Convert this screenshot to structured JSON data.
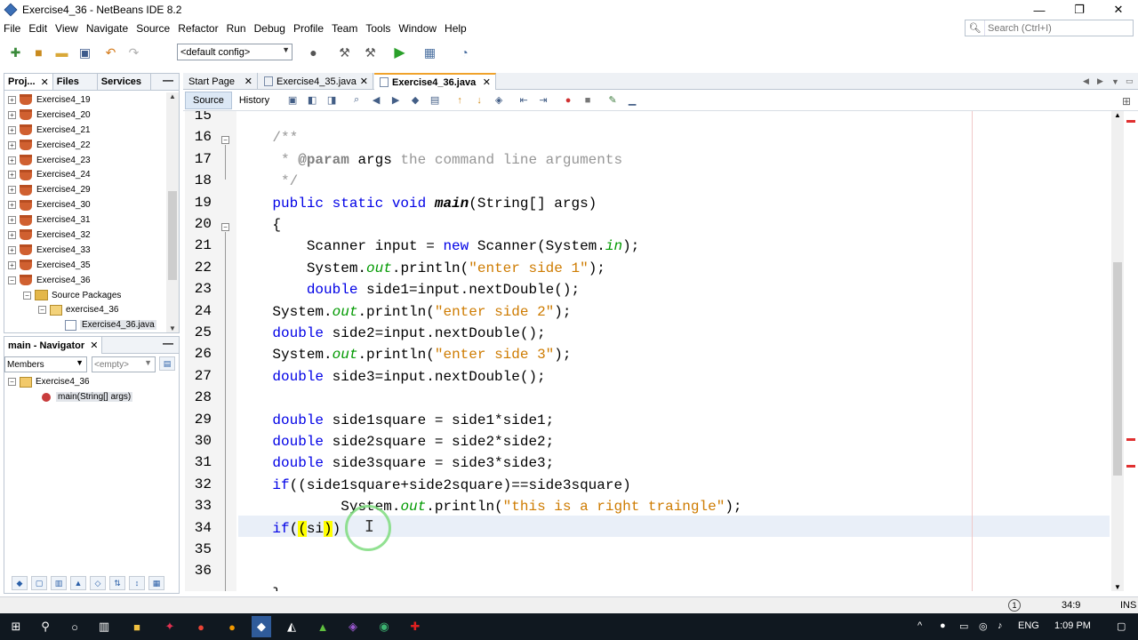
{
  "window": {
    "title": "Exercise4_36 - NetBeans IDE 8.2",
    "min": "—",
    "max": "❐",
    "close": "✕"
  },
  "menu": [
    "File",
    "Edit",
    "View",
    "Navigate",
    "Source",
    "Refactor",
    "Run",
    "Debug",
    "Profile",
    "Team",
    "Tools",
    "Window",
    "Help"
  ],
  "search": {
    "placeholder": "Search (Ctrl+I)"
  },
  "toolbar": {
    "config": "<default config>"
  },
  "projects_panel": {
    "tabs": [
      "Proj...",
      "Files",
      "Services"
    ],
    "close": "✕",
    "minimize": "—",
    "items": [
      {
        "label": "Exercise4_19",
        "indent": 0,
        "type": "project",
        "exp": "+"
      },
      {
        "label": "Exercise4_20",
        "indent": 0,
        "type": "project",
        "exp": "+"
      },
      {
        "label": "Exercise4_21",
        "indent": 0,
        "type": "project",
        "exp": "+"
      },
      {
        "label": "Exercise4_22",
        "indent": 0,
        "type": "project",
        "exp": "+"
      },
      {
        "label": "Exercise4_23",
        "indent": 0,
        "type": "project",
        "exp": "+"
      },
      {
        "label": "Exercise4_24",
        "indent": 0,
        "type": "project",
        "exp": "+"
      },
      {
        "label": "Exercise4_29",
        "indent": 0,
        "type": "project",
        "exp": "+"
      },
      {
        "label": "Exercise4_30",
        "indent": 0,
        "type": "project",
        "exp": "+"
      },
      {
        "label": "Exercise4_31",
        "indent": 0,
        "type": "project",
        "exp": "+"
      },
      {
        "label": "Exercise4_32",
        "indent": 0,
        "type": "project",
        "exp": "+"
      },
      {
        "label": "Exercise4_33",
        "indent": 0,
        "type": "project",
        "exp": "+"
      },
      {
        "label": "Exercise4_35",
        "indent": 0,
        "type": "project",
        "exp": "+"
      },
      {
        "label": "Exercise4_36",
        "indent": 0,
        "type": "project",
        "exp": "−"
      },
      {
        "label": "Source Packages",
        "indent": 1,
        "type": "folder",
        "exp": "−"
      },
      {
        "label": "exercise4_36",
        "indent": 2,
        "type": "package",
        "exp": "−"
      },
      {
        "label": "Exercise4_36.java",
        "indent": 3,
        "type": "file",
        "exp": ""
      }
    ]
  },
  "navigator": {
    "title": "main - Navigator",
    "close": "✕",
    "minimize": "—",
    "members_label": "Members",
    "filter_label": "<empty>",
    "items": [
      {
        "label": "Exercise4_36",
        "type": "class"
      },
      {
        "label": "main(String[] args)",
        "type": "method"
      }
    ]
  },
  "editor_tabs": [
    {
      "label": "Start Page",
      "active": false
    },
    {
      "label": "Exercise4_35.java",
      "active": false
    },
    {
      "label": "Exercise4_36.java",
      "active": true
    }
  ],
  "editor_toolbar": {
    "source": "Source",
    "history": "History"
  },
  "code_lines": [
    {
      "n": "15",
      "html": ""
    },
    {
      "n": "16",
      "html": "<span class=\"cm\">    /**</span>"
    },
    {
      "n": "17",
      "html": "<span class=\"cm\">     * </span><span class=\"cmtag\">@param</span><span class=\"cm\"> </span>args<span class=\"cm\"> the command line arguments</span>"
    },
    {
      "n": "18",
      "html": "<span class=\"cm\">     */</span>"
    },
    {
      "n": "19",
      "html": "    <span class=\"kw\">public static void</span> <span class=\"mth\">main</span>(String[] args)"
    },
    {
      "n": "20",
      "html": "    {"
    },
    {
      "n": "21",
      "html": "        Scanner input = <span class=\"kw\">new</span> Scanner(System.<span class=\"fld\">in</span>);"
    },
    {
      "n": "22",
      "html": "        System.<span class=\"fld\">out</span>.println(<span class=\"str\">\"enter side 1\"</span>);"
    },
    {
      "n": "23",
      "html": "        <span class=\"kw\">double</span> side1=input.nextDouble();"
    },
    {
      "n": "24",
      "html": "    System.<span class=\"fld\">out</span>.println(<span class=\"str\">\"enter side 2\"</span>);"
    },
    {
      "n": "25",
      "html": "    <span class=\"kw\">double</span> side2=input.nextDouble();"
    },
    {
      "n": "26",
      "html": "    System.<span class=\"fld\">out</span>.println(<span class=\"str\">\"enter side 3\"</span>);"
    },
    {
      "n": "27",
      "html": "    <span class=\"kw\">double</span> side3=input.nextDouble();"
    },
    {
      "n": "28",
      "html": ""
    },
    {
      "n": "29",
      "html": "    <span class=\"kw\">double</span> side1square = side1*side1;"
    },
    {
      "n": "30",
      "html": "    <span class=\"kw\">double</span> side2square = side2*side2;"
    },
    {
      "n": "31",
      "html": "    <span class=\"kw\">double</span> side3square = side3*side3;"
    },
    {
      "n": "32",
      "html": "    <span class=\"kw\">if</span>((side1square+side2square)==side3square)"
    },
    {
      "n": "33",
      "html": "            System.<span class=\"fld\">out</span>.println(<span class=\"str\">\"this is a right traingle\"</span>);"
    },
    {
      "n": "34",
      "html": "    <span class=\"kw\">if</span>(<span class=\"hl\">(</span>si<span class=\"hl\">)</span>)"
    },
    {
      "n": "35",
      "html": ""
    },
    {
      "n": "36",
      "html": ""
    },
    {
      "n": "",
      "html": "    }"
    }
  ],
  "status": {
    "position": "34:9",
    "mode": "INS",
    "notification": "1"
  },
  "taskbar": {
    "language": "ENG",
    "time": "1:09 PM"
  }
}
